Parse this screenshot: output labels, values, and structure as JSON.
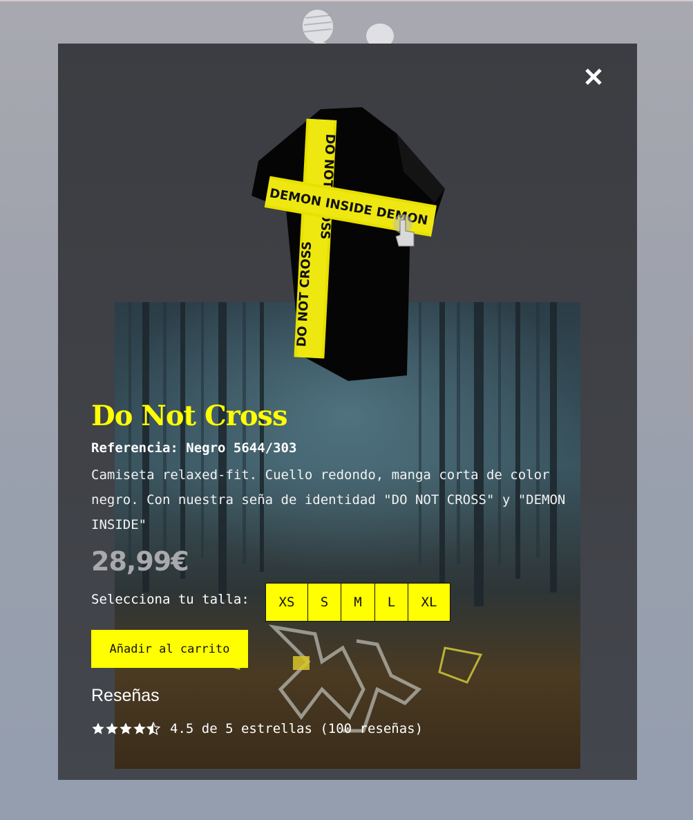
{
  "modal": {
    "close_icon": "close-icon",
    "product_image_alt": "",
    "colors": {
      "accent": "#ffff00",
      "modal_bg": "#3f4146",
      "price": "#a9a9ad"
    }
  },
  "product": {
    "title": "Do Not Cross",
    "reference": "Referencia: Negro 5644/303",
    "description": "Camiseta relaxed-fit. Cuello redondo, manga corta de color negro. Con nuestra seña de identidad \"DO NOT CROSS\" y \"DEMON INSIDE\"",
    "price": "28,99€",
    "tape_text_vertical": "DO NOT CROSS",
    "tape_text_horizontal": "DEMON INSIDE DEMON"
  },
  "sizes": {
    "label": "Selecciona tu talla:",
    "options": [
      "XS",
      "S",
      "M",
      "L",
      "XL"
    ]
  },
  "cart": {
    "label": "Añadir al carrito"
  },
  "reviews": {
    "heading": "Reseñas",
    "rating": 4.5,
    "max": 5,
    "text": "4.5 de 5 estrellas (100 reseñas)"
  }
}
